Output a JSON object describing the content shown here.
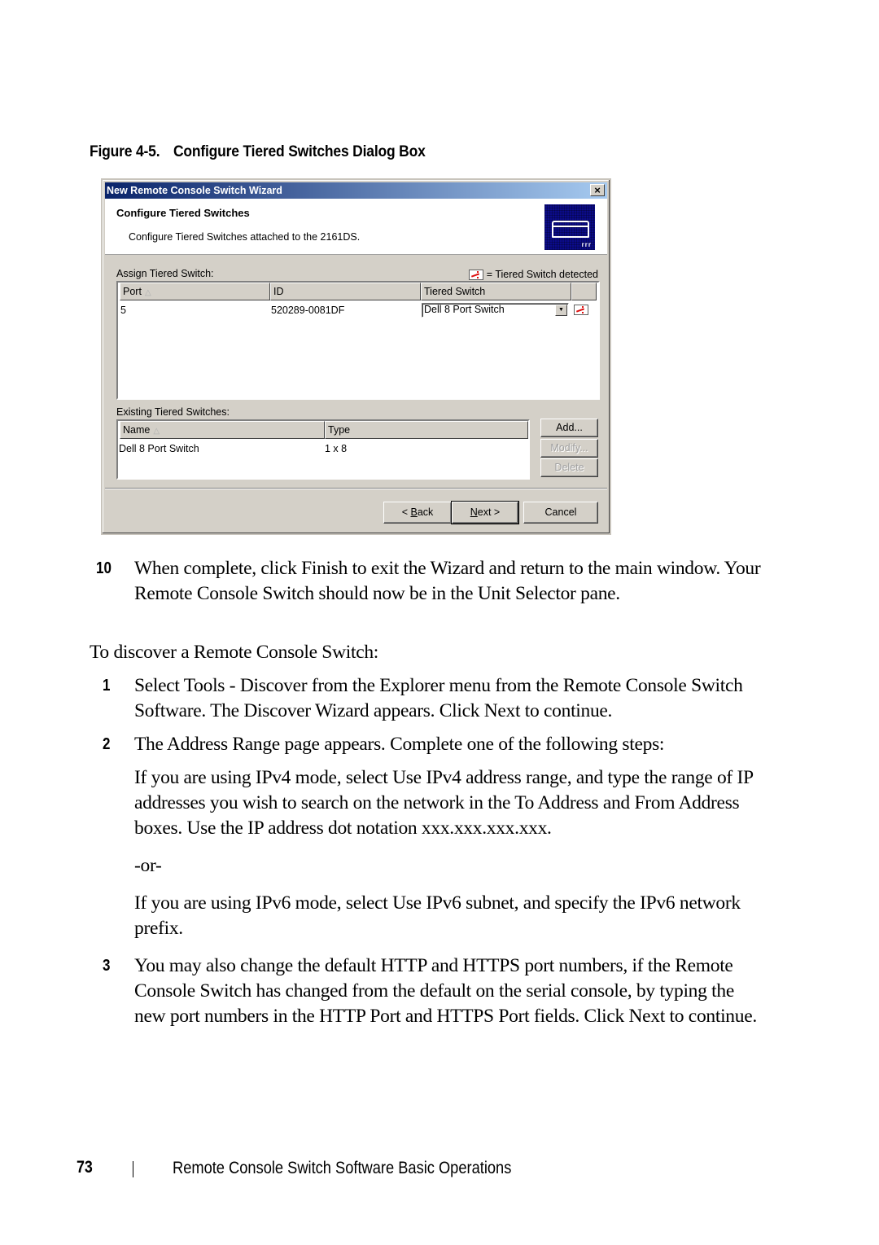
{
  "figure": {
    "number": "Figure 4-5.",
    "title": "Configure Tiered Switches Dialog Box"
  },
  "dialog": {
    "window_title": "New Remote Console Switch Wizard",
    "close_label": "×",
    "header_title": "Configure Tiered Switches",
    "header_subtitle": "Configure Tiered Switches attached to the 2161DS.",
    "header_icon": "switch-device-icon",
    "header_icon_leds": "rrr",
    "assign_label": "Assign Tiered Switch:",
    "legend_text": "= Tiered Switch detected",
    "assign_table": {
      "columns": [
        "Port",
        "ID",
        "Tiered Switch",
        ""
      ],
      "sort_indicator": "△",
      "rows": [
        {
          "port": "5",
          "id": "520289-0081DF",
          "tiered_switch": "Dell 8 Port Switch"
        }
      ],
      "combo_arrow": "▼"
    },
    "existing_label": "Existing Tiered Switches:",
    "existing_table": {
      "columns": [
        "Name",
        "Type"
      ],
      "sort_indicator": "△",
      "rows": [
        {
          "name": "Dell 8 Port Switch",
          "type": "1 x 8"
        }
      ]
    },
    "side_buttons": {
      "add": "Add...",
      "modify": "Modify...",
      "delete": "Delete"
    },
    "nav_buttons": {
      "back_prefix": "< ",
      "back_mnemonic": "B",
      "back_rest": "ack",
      "next_mnemonic": "N",
      "next_rest": "ext >",
      "cancel": "Cancel"
    }
  },
  "body": {
    "step10": {
      "num": "10",
      "text": "When complete, click Finish to exit the Wizard and return to the main window. Your Remote Console Switch should now be in the Unit Selector pane."
    },
    "intro": "To discover a Remote Console Switch:",
    "step1": {
      "num": "1",
      "text": "Select Tools - Discover from the Explorer menu from the Remote Console Switch Software. The Discover Wizard appears. Click Next to continue."
    },
    "step2": {
      "num": "2",
      "text": "The Address Range page appears. Complete one of the following steps:",
      "ipv4": "If you are using IPv4 mode, select Use IPv4 address range, and type the range of IP addresses you wish to search on the network in the To Address and From Address boxes. Use the IP address dot notation xxx.xxx.xxx.xxx.",
      "or": "-or-",
      "ipv6": "If you are using IPv6 mode, select Use IPv6 subnet, and specify the IPv6 network prefix."
    },
    "step3": {
      "num": "3",
      "text": "You may also change the default HTTP and HTTPS port numbers, if the Remote Console Switch has changed from the default on the serial console, by typing the new port numbers in the HTTP Port and HTTPS Port fields. Click Next to continue."
    }
  },
  "footer": {
    "page_number": "73",
    "section_title": "Remote Console Switch Software Basic Operations"
  }
}
